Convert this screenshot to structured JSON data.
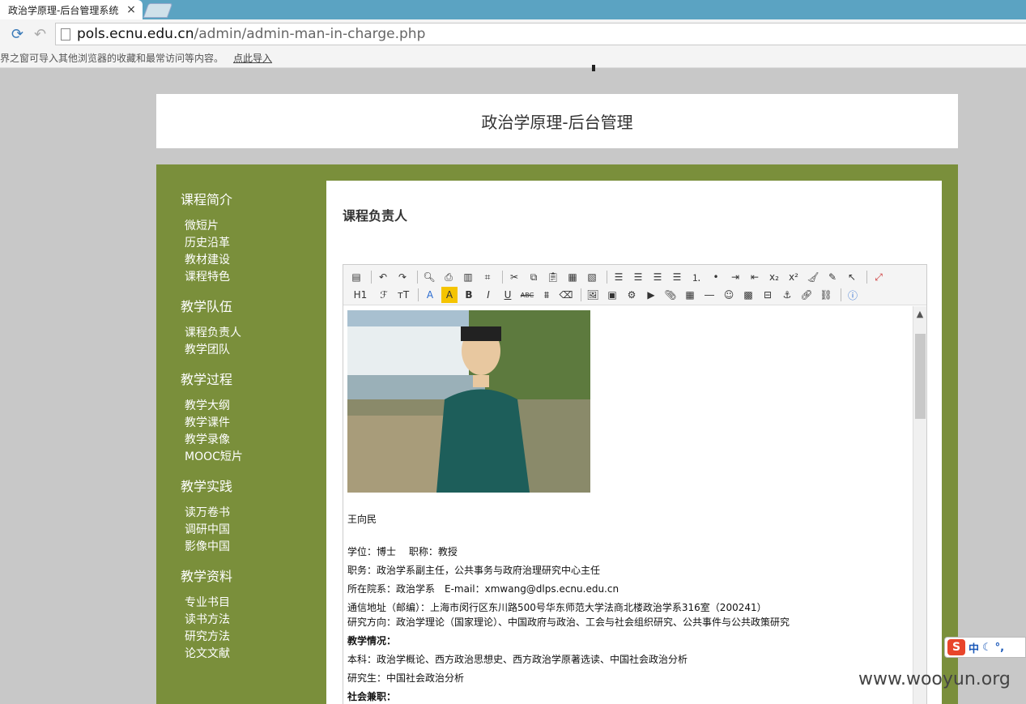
{
  "browser": {
    "tab_title": "政治学原理-后台管理系统",
    "tab_close": "×",
    "url_host": "pols.ecnu.edu.cn",
    "url_path": "/admin/admin-man-in-charge.php",
    "bookmark_notice": "界之窗可导入其他浏览器的收藏和最常访问等内容。",
    "bookmark_link": "点此导入"
  },
  "header": {
    "title": "政治学原理-后台管理"
  },
  "sidebar": {
    "groups": [
      {
        "heading": "课程简介",
        "items": [
          "微短片",
          "历史沿革",
          "教材建设",
          "课程特色"
        ]
      },
      {
        "heading": "教学队伍",
        "items": [
          "课程负责人",
          "教学团队"
        ]
      },
      {
        "heading": "教学过程",
        "items": [
          "教学大纲",
          "教学课件",
          "教学录像",
          "MOOC短片"
        ]
      },
      {
        "heading": "教学实践",
        "items": [
          "读万卷书",
          "调研中国",
          "影像中国"
        ]
      },
      {
        "heading": "教学资料",
        "items": [
          "专业书目",
          "读书方法",
          "研究方法",
          "论文文献"
        ]
      }
    ]
  },
  "content": {
    "title": "课程负责人",
    "editor": {
      "name": "王向民",
      "line1": "学位：博士　 职称：教授",
      "line2": "职务：政治学系副主任，公共事务与政府治理研究中心主任",
      "line3": "所在院系：政治学系　E-mail：xmwang@dlps.ecnu.edu.cn",
      "line4": "通信地址（邮编）：上海市闵行区东川路500号华东师范大学法商北楼政治学系316室（200241）",
      "line5": "研究方向：政治学理论（国家理论）、中国政府与政治、工会与社会组织研究、公共事件与公共政策研究",
      "teaching_heading": "教学情况：",
      "undergrad": "本科：政治学概论、西方政治思想史、西方政治学原著选读、中国社会政治分析",
      "graduate": "研究生：中国社会政治分析",
      "social_heading": "社会兼职："
    },
    "toolbar": {
      "h1": "H1",
      "font_family": "ℱ",
      "font_size": "тT",
      "font_color": "A",
      "highlight": "A",
      "bold": "B",
      "italic": "I",
      "underline": "U",
      "strike": "ABC"
    }
  },
  "ime": {
    "logo": "S",
    "lang": "中"
  },
  "watermark": "www.wooyun.org"
}
